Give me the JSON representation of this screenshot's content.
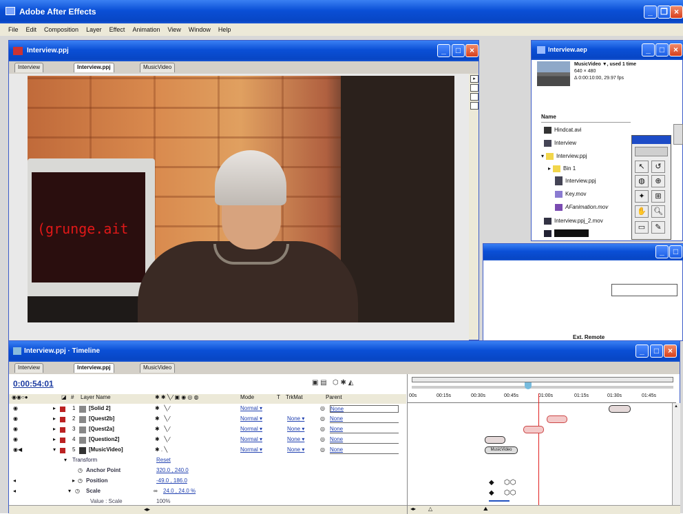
{
  "app": {
    "title": "Adobe After Effects",
    "menu": [
      "File",
      "Edit",
      "Composition",
      "Layer",
      "Effect",
      "Animation",
      "View",
      "Window",
      "Help"
    ]
  },
  "comp_window": {
    "title": "Interview.ppj",
    "tabs": [
      "Interview",
      "Interview.ppj",
      "MusicVideo"
    ],
    "screen_text": "(grunge.ait"
  },
  "project": {
    "title": "Interview.aep",
    "info_name": "MusicVideo ▼, used 1 time",
    "info_dims": "640 × 480",
    "info_duration": "Δ 0:00:10:00, 29.97 fps",
    "column_name": "Name",
    "items": [
      "Hindcat.avi",
      "Interview",
      "Interview.ppj",
      "Bin 1",
      "Interview.ppj",
      "Key.mov",
      "AFanimation.mov",
      "Interview.ppj_2.mov"
    ],
    "selected_label": ""
  },
  "info_panel": {
    "label": "Ext. Remote"
  },
  "timeline": {
    "title": "Interview.ppj · Timeline",
    "tabs": [
      "Interview",
      "Interview.ppj",
      "MusicVideo"
    ],
    "timecode": "0:00:54:01",
    "col_layer": "Layer Name",
    "col_mode": "Mode",
    "col_t": "T",
    "col_trkmat": "TrkMat",
    "col_parent": "Parent",
    "ruler": [
      "00s",
      "00:15s",
      "00:30s",
      "00:45s",
      "01:00s",
      "01:15s",
      "01:30s",
      "01:45s"
    ],
    "layers": [
      {
        "num": "1",
        "name": "[Solid 2]",
        "mode": "Normal ▾",
        "trkmat": "",
        "parent": "None"
      },
      {
        "num": "2",
        "name": "[Quest2b]",
        "mode": "Normal ▾",
        "trkmat": "None ▾",
        "parent": "None"
      },
      {
        "num": "3",
        "name": "[Quest2a]",
        "mode": "Normal ▾",
        "trkmat": "None ▾",
        "parent": "None"
      },
      {
        "num": "4",
        "name": "[Question2]",
        "mode": "Normal ▾",
        "trkmat": "None ▾",
        "parent": "None"
      },
      {
        "num": "5",
        "name": "[MusicVideo]",
        "mode": "Normal ▾",
        "trkmat": "None ▾",
        "parent": "None"
      }
    ],
    "transform": {
      "label": "Transform",
      "reset": "Reset",
      "anchor_label": "Anchor Point",
      "anchor_value": "320.0 , 240.0",
      "position_label": "Position",
      "position_value": "-49.0 , 186.0",
      "scale_label": "Scale",
      "scale_value": "24.0 , 24.0 %",
      "value_label": "Value : Scale",
      "value_value": "100%"
    },
    "bar_label": "MusicVideo"
  }
}
